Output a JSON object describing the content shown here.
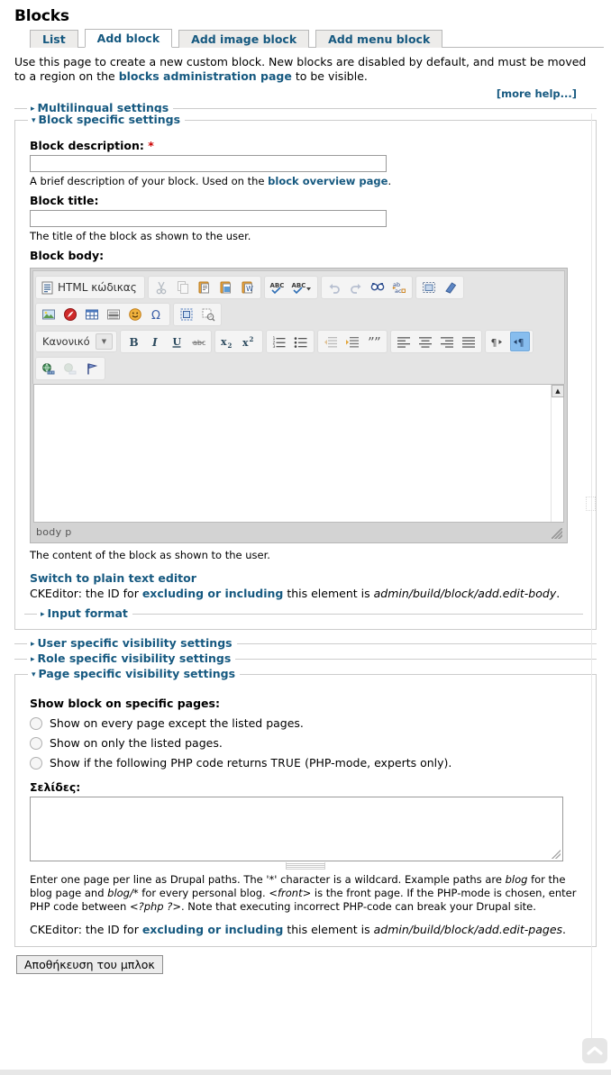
{
  "page": {
    "title": "Blocks",
    "more_help": "[more help...]"
  },
  "tabs": [
    {
      "label": "List",
      "active": false
    },
    {
      "label": "Add block",
      "active": true
    },
    {
      "label": "Add image block",
      "active": false
    },
    {
      "label": "Add menu block",
      "active": false
    }
  ],
  "intro": {
    "part1": "Use this page to create a new custom block. New blocks are disabled by default, and must be moved to a region on the ",
    "link": "blocks administration page",
    "part2": " to be visible."
  },
  "fieldsets": {
    "multilingual": "Multilingual settings",
    "block_specific": "Block specific settings",
    "input_format": "Input format",
    "user_visibility": "User specific visibility settings",
    "role_visibility": "Role specific visibility settings",
    "page_visibility": "Page specific visibility settings"
  },
  "block_description": {
    "label": "Block description:",
    "required_mark": "*",
    "value": "",
    "desc_part1": "A brief description of your block. Used on the ",
    "desc_link": "block overview page",
    "desc_part2": "."
  },
  "block_title": {
    "label": "Block title:",
    "value": "",
    "desc": "The title of the block as shown to the user."
  },
  "block_body": {
    "label": "Block body:",
    "desc": "The content of the block as shown to the user.",
    "switch_link": "Switch to plain text editor",
    "note_part1": "CKEditor: the ID for ",
    "note_link": "excluding or including",
    "note_part2": " this element is ",
    "note_id": "admin/build/block/add.edit-body",
    "note_end": "."
  },
  "editor": {
    "source_button": "HTML κώδικας",
    "format_value": "Κανονικό",
    "path": "body  p",
    "toolbar_rows": [
      {
        "groups": [
          {
            "name": "document",
            "buttons": [
              {
                "icon": "source-icon",
                "label": "HTML κώδικας",
                "wide": true
              }
            ]
          },
          {
            "name": "clipboard",
            "buttons": [
              {
                "icon": "cut-icon"
              },
              {
                "icon": "copy-icon"
              },
              {
                "icon": "paste-icon"
              },
              {
                "icon": "paste-text-icon"
              },
              {
                "icon": "paste-word-icon"
              }
            ]
          },
          {
            "name": "spellcheck",
            "buttons": [
              {
                "icon": "spellcheck-icon"
              },
              {
                "icon": "scayt-icon"
              }
            ]
          },
          {
            "name": "undo",
            "buttons": [
              {
                "icon": "undo-icon"
              },
              {
                "icon": "redo-icon"
              },
              {
                "icon": "find-icon"
              },
              {
                "icon": "replace-icon"
              }
            ]
          },
          {
            "name": "selection",
            "buttons": [
              {
                "icon": "select-all-icon"
              },
              {
                "icon": "remove-format-icon"
              }
            ]
          }
        ]
      },
      {
        "groups": [
          {
            "name": "insert",
            "buttons": [
              {
                "icon": "image-icon"
              },
              {
                "icon": "flash-icon"
              },
              {
                "icon": "table-icon"
              },
              {
                "icon": "horizontal-rule-icon"
              },
              {
                "icon": "smiley-icon"
              },
              {
                "icon": "special-char-icon"
              }
            ]
          },
          {
            "name": "tools",
            "buttons": [
              {
                "icon": "page-break-icon"
              },
              {
                "icon": "show-blocks-icon"
              }
            ]
          }
        ]
      },
      {
        "groups": [
          {
            "name": "format",
            "buttons": [
              {
                "icon": "format-combo",
                "label": "Κανονικό",
                "combo": true
              }
            ]
          },
          {
            "name": "basicstyles",
            "buttons": [
              {
                "icon": "bold-icon"
              },
              {
                "icon": "italic-icon"
              },
              {
                "icon": "underline-icon"
              },
              {
                "icon": "strike-icon"
              }
            ]
          },
          {
            "name": "scripts",
            "buttons": [
              {
                "icon": "subscript-icon"
              },
              {
                "icon": "superscript-icon"
              }
            ]
          },
          {
            "name": "lists",
            "buttons": [
              {
                "icon": "numbered-list-icon"
              },
              {
                "icon": "bulleted-list-icon"
              }
            ]
          },
          {
            "name": "indent",
            "buttons": [
              {
                "icon": "outdent-icon"
              },
              {
                "icon": "indent-icon"
              },
              {
                "icon": "blockquote-icon"
              }
            ]
          },
          {
            "name": "align",
            "buttons": [
              {
                "icon": "align-left-icon"
              },
              {
                "icon": "align-center-icon"
              },
              {
                "icon": "align-right-icon"
              },
              {
                "icon": "align-justify-icon"
              }
            ]
          },
          {
            "name": "direction",
            "buttons": [
              {
                "icon": "rtl-icon"
              },
              {
                "icon": "ltr-icon",
                "active": true
              }
            ]
          }
        ]
      },
      {
        "groups": [
          {
            "name": "links",
            "buttons": [
              {
                "icon": "link-icon"
              },
              {
                "icon": "unlink-icon"
              },
              {
                "icon": "anchor-icon"
              }
            ]
          }
        ]
      }
    ]
  },
  "page_visibility": {
    "heading": "Show block on specific pages:",
    "options": [
      {
        "label": "Show on every page except the listed pages.",
        "selected": false
      },
      {
        "label": "Show on only the listed pages.",
        "selected": false
      },
      {
        "label_pre": "Show if the following PHP code returns ",
        "label_code": "TRUE",
        "label_post": " (PHP-mode, experts only).",
        "selected": false
      }
    ],
    "pages_label": "Σελίδες:",
    "pages_value": "",
    "desc_line1": "Enter one page per line as Drupal paths. The '*' character is a wildcard. Example paths are ",
    "desc_blog1": "blog",
    "desc_line2": " for the blog page and ",
    "desc_blog2": "blog/*",
    "desc_line3": " for every personal blog. ",
    "desc_front": "<front>",
    "desc_line4": " is the front page. If the PHP-mode is chosen, enter PHP code between ",
    "desc_php": "<?php ?>",
    "desc_line5": ". Note that executing incorrect PHP-code can break your Drupal site.",
    "note_part1": "CKEditor: the ID for ",
    "note_link": "excluding or including",
    "note_part2": " this element is ",
    "note_id": "admin/build/block/add.edit-pages",
    "note_end": "."
  },
  "footer": {
    "submit_label": "Αποθήκευση του μπλοκ",
    "back_to_top": "back-to-top-icon"
  },
  "colors": {
    "link": "#165980",
    "required": "#cc0000",
    "active_toolbar": "#87bdee",
    "fieldset_border": "#cccccc"
  }
}
